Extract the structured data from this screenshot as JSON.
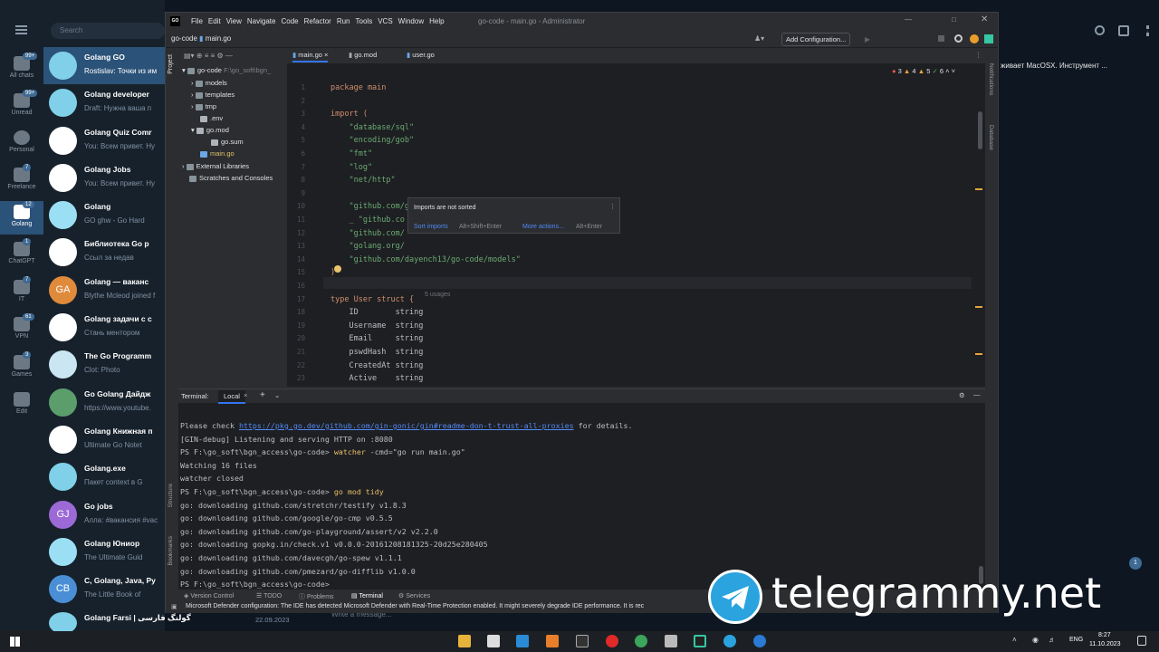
{
  "telegram": {
    "search_placeholder": "Search",
    "rail": [
      {
        "label": "All chats",
        "badge": "99+"
      },
      {
        "label": "Unread",
        "badge": "99+"
      },
      {
        "label": "Personal",
        "badge": ""
      },
      {
        "label": "Freelance",
        "badge": "7"
      },
      {
        "label": "Golang",
        "badge": "12"
      },
      {
        "label": "ChatGPT",
        "badge": "1"
      },
      {
        "label": "IT",
        "badge": "7"
      },
      {
        "label": "VPN",
        "badge": "61"
      },
      {
        "label": "Games",
        "badge": "3"
      },
      {
        "label": "Edit",
        "badge": ""
      }
    ],
    "chats": [
      {
        "name": "Golang GO",
        "msg": "Rostislav: Точки из им"
      },
      {
        "name": "Golang developer",
        "msg": "Draft: Нужна ваша п"
      },
      {
        "name": "Golang Quiz Comr",
        "msg": "You: Всем привет. Ну"
      },
      {
        "name": "Golang Jobs",
        "msg": "You: Всем привет. Ну"
      },
      {
        "name": "Golang",
        "msg": "GO ghw - Go Hard"
      },
      {
        "name": "Библиотека Go p",
        "msg": "Ссыл за недав"
      },
      {
        "name": "Golang — ваканс",
        "msg": "Blythe Mcleod joined f"
      },
      {
        "name": "Golang задачи с с",
        "msg": "Стань ментором"
      },
      {
        "name": "The Go Programm",
        "msg": "Clot: Photo"
      },
      {
        "name": "Go Golang Дайдж",
        "msg": "https://www.youtube."
      },
      {
        "name": "Golang Книжная п",
        "msg": "Ultimate Go Notet"
      },
      {
        "name": "Golang.exe",
        "msg": "Пакет context в G"
      },
      {
        "name": "Go jobs",
        "msg": "Алла: #вакансия #vac"
      },
      {
        "name": "Golang Юниор",
        "msg": "The Ultimate Guid"
      },
      {
        "name": "C, Golang, Java, Py",
        "msg": "The Little Book of"
      },
      {
        "name": "Golang Farsi | گولنگ فارسی",
        "msg": "22.09.2023"
      }
    ],
    "avatar_letters": {
      "ga": "GA",
      "gj": "GJ",
      "cb": "CB"
    },
    "right_preview": "живает MacOSX. Инструмент ...",
    "message_placeholder": "Write a message..."
  },
  "ide": {
    "logo": "GO",
    "menu": [
      "File",
      "Edit",
      "View",
      "Navigate",
      "Code",
      "Refactor",
      "Run",
      "Tools",
      "VCS",
      "Window",
      "Help"
    ],
    "title": "go-code - main.go - Administrator",
    "breadcrumb": [
      "go-code",
      "main.go"
    ],
    "add_config": "Add Configuration...",
    "project_label": "Project",
    "tree": [
      {
        "label": "go-code",
        "suffix": "F:\\go_soft\\bgn_"
      },
      {
        "label": "models"
      },
      {
        "label": "templates"
      },
      {
        "label": "tmp"
      },
      {
        "label": ".env"
      },
      {
        "label": "go.mod"
      },
      {
        "label": "go.sum"
      },
      {
        "label": "main.go"
      },
      {
        "label": "External Libraries"
      },
      {
        "label": "Scratches and Consoles"
      }
    ],
    "tabs": [
      "main.go",
      "go.mod",
      "user.go"
    ],
    "inspections": {
      "errors": "3",
      "warnings": "4",
      "weak": "5",
      "ok": "6"
    },
    "code": [
      "package main",
      "",
      "import (",
      "    \"database/sql\"",
      "    \"encoding/gob\"",
      "    \"fmt\"",
      "    \"log\"",
      "    \"net/http\"",
      "",
      "    \"github.com/gin-gonic/gin\"",
      "    _ \"github.co",
      "    \"github.com/",
      "    \"golang.org/",
      "    \"github.com/dayench13/go-code/models\"",
      ")",
      "",
      "type User struct {",
      "    ID        string",
      "    Username  string",
      "    Email     string",
      "    pswdHash  string",
      "    CreatedAt string",
      "    Active    string"
    ],
    "usages": "5 usages",
    "popup": {
      "title": "Imports are not sorted",
      "action1": "Sort imports",
      "shortcut1": "Alt+Shift+Enter",
      "action2": "More actions...",
      "shortcut2": "Alt+Enter"
    },
    "terminal": {
      "tab_label": "Terminal:",
      "tab_local": "Local",
      "lines": [
        {
          "pre": "Please check ",
          "link": "https://pkg.go.dev/github.com/gin-gonic/gin#readme-don-t-trust-all-proxies",
          "post": " for details."
        },
        {
          "pre": "[GIN-debug] Listening and serving HTTP on :8080"
        },
        {
          "pre": "PS F:\\go_soft\\bgn_access\\go-code> ",
          "cmd": "watcher",
          "post": " -cmd=\"go run main.go\""
        },
        {
          "pre": "Watching 16 files"
        },
        {
          "pre": "watcher closed"
        },
        {
          "pre": "PS F:\\go_soft\\bgn_access\\go-code> ",
          "cmd": "go mod tidy"
        },
        {
          "pre": "go: downloading github.com/stretchr/testify v1.8.3"
        },
        {
          "pre": "go: downloading github.com/google/go-cmp v0.5.5"
        },
        {
          "pre": "go: downloading github.com/go-playground/assert/v2 v2.2.0"
        },
        {
          "pre": "go: downloading gopkg.in/check.v1 v0.0.0-20161208181325-20d25e280405"
        },
        {
          "pre": "go: downloading github.com/davecgh/go-spew v1.1.1"
        },
        {
          "pre": "go: downloading github.com/pmezard/go-difflib v1.0.0"
        },
        {
          "pre": "PS F:\\go_soft\\bgn_access\\go-code> "
        }
      ]
    },
    "bottom_tabs": [
      "Version Control",
      "TODO",
      "Problems",
      "Terminal",
      "Services"
    ],
    "side_right": [
      "Notifications",
      "Database"
    ],
    "side_left": [
      "Structure",
      "Bookmarks"
    ],
    "status": "Microsoft Defender configuration: The IDE has detected Microsoft Defender with Real-Time Protection enabled. It might severely degrade IDE performance. It is rec"
  },
  "taskbar": {
    "lang": "ENG",
    "time": "8:27",
    "date": "11.10.2023",
    "notif": "1"
  },
  "watermark": "telegrammy.net"
}
